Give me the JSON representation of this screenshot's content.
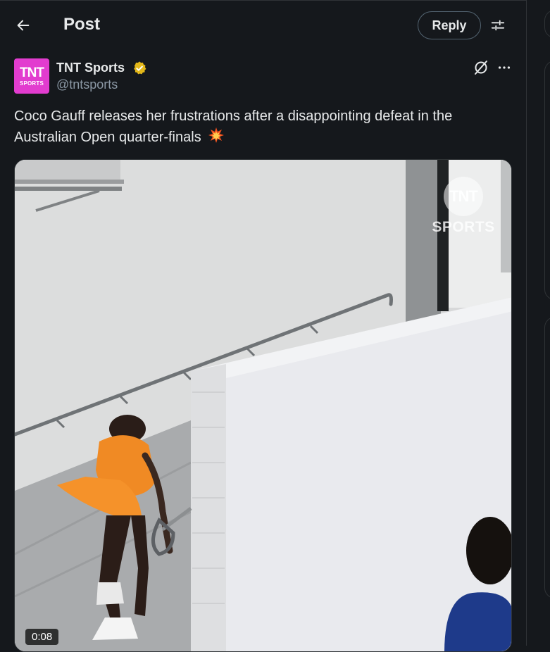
{
  "header": {
    "title": "Post",
    "reply_label": "Reply",
    "back_icon": "arrow-left-icon",
    "filter_icon": "sliders-icon"
  },
  "post": {
    "author": {
      "display_name": "TNT Sports",
      "handle": "@tntsports",
      "avatar_text_big": "TNT",
      "avatar_text_small": "SPORTS",
      "verified_color": "#e2b719",
      "avatar_color": "#e23ccf"
    },
    "text": "Coco Gauff releases her frustrations after a disappointing defeat in the Australian Open quarter-finals",
    "text_emoji": "collision-icon",
    "media": {
      "type": "video",
      "duration": "0:08",
      "watermark_big": "TNT",
      "watermark_small": "SPORTS"
    }
  },
  "colors": {
    "background": "#15181c",
    "text_primary": "#e7e9ea",
    "text_secondary": "#8b98a5",
    "border": "#2f3336"
  }
}
